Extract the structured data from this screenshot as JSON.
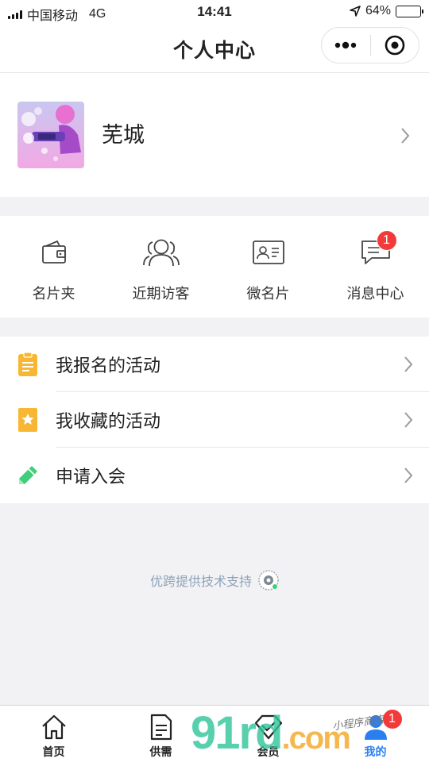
{
  "status_bar": {
    "carrier": "中国移动",
    "network": "4G",
    "time": "14:41",
    "battery": "64%",
    "battery_level": 0.64
  },
  "nav": {
    "title": "个人中心"
  },
  "profile": {
    "name": "芜城"
  },
  "quick_actions": [
    {
      "label": "名片夹",
      "icon": "wallet-icon"
    },
    {
      "label": "近期访客",
      "icon": "visitors-icon"
    },
    {
      "label": "微名片",
      "icon": "id-card-icon"
    },
    {
      "label": "消息中心",
      "icon": "message-icon",
      "badge": "1"
    }
  ],
  "menu": [
    {
      "label": "我报名的活动",
      "icon": "clipboard-icon",
      "color": "#f7b733"
    },
    {
      "label": "我收藏的活动",
      "icon": "star-bookmark-icon",
      "color": "#f7b733"
    },
    {
      "label": "申请入会",
      "icon": "pencil-icon",
      "color": "#3fcf7a"
    }
  ],
  "support_text": "优跨提供技术支持",
  "tabbar": [
    {
      "label": "首页",
      "icon": "home-icon"
    },
    {
      "label": "供需",
      "icon": "document-icon"
    },
    {
      "label": "会员",
      "icon": "diamond-icon"
    },
    {
      "label": "我的",
      "icon": "person-icon",
      "active": true,
      "badge": "1"
    }
  ],
  "watermark": {
    "main": "91rd",
    "suffix": ".com",
    "script": "小程序商店"
  },
  "colors": {
    "accent": "#2a7ff0",
    "badge": "#f23a3a",
    "background": "#f2f2f4"
  }
}
